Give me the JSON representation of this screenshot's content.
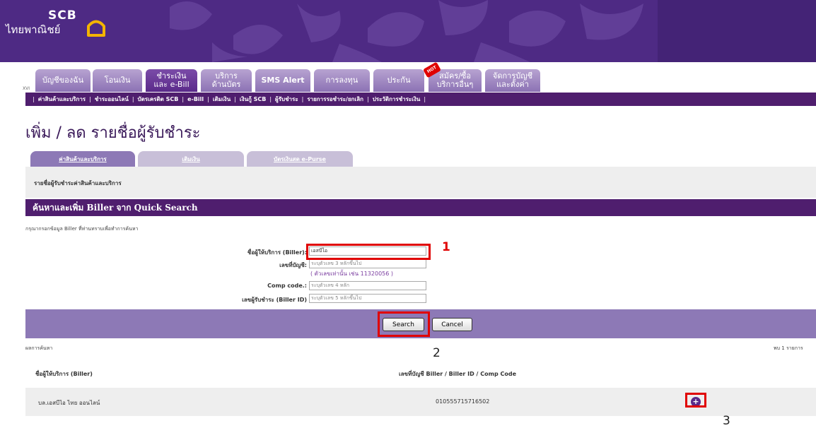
{
  "brand": {
    "name": "SCB",
    "thai_name": "ไทยพาณิชย์"
  },
  "nav": {
    "xvi": "XVI",
    "tabs": [
      {
        "label": "บัญชีของฉัน"
      },
      {
        "label": "โอนเงิน"
      },
      {
        "label": "ชำระเงิน\nและ e-Bill"
      },
      {
        "label": "บริการ\nด้านบัตร"
      },
      {
        "label": "SMS Alert"
      },
      {
        "label": "การลงทุน"
      },
      {
        "label": "ประกัน"
      },
      {
        "label": "สมัคร/ซื้อ\nบริการอื่นๆ"
      },
      {
        "label": "จัดการบัญชี\nและตั้งค่า"
      }
    ],
    "hot_badge": "HOT"
  },
  "subnav": {
    "items": [
      "ค่าสินค้าและบริการ",
      "ชำระออนไลน์",
      "บัตรเครดิต SCB",
      "e-Bill",
      "เติมเงิน",
      "เงินกู้ SCB",
      "ผู้รับชำระ",
      "รายการรอชำระ/ยกเลิก",
      "ประวัติการชำระเงิน"
    ]
  },
  "page": {
    "title": "เพิ่ม / ลด รายชื่อผู้รับชำระ"
  },
  "content_tabs": [
    "ค่าสินค้าและบริการ",
    "เติมเงิน",
    "บัตรเงินสด e-Purse"
  ],
  "section": {
    "list_label": "รายชื่อผู้รับชำระค่าสินค้าและบริการ",
    "search_header": "ค้นหาและเพิ่ม Biller จาก Quick Search",
    "hint": "กรุณากรอกข้อมูล Biller ที่ท่านทราบเพื่อทำการค้นหา"
  },
  "form": {
    "biller_label": "ชื่อผู้ให้บริการ (Biller):",
    "biller_value": "เอสบีไอ",
    "account_label": "เลขที่บัญชี:",
    "account_placeholder": "ระบุตัวเลข 3 หลักขึ้นไป",
    "account_note": "( ตัวเลขเท่านั้น เช่น 11320056 )",
    "comp_label": "Comp code.:",
    "comp_placeholder": "ระบุตัวเลข 4 หลัก",
    "billerid_label": "เลขผู้รับชำระ (Biller ID)",
    "billerid_placeholder": "ระบุตัวเลข 5 หลักขึ้นไป"
  },
  "buttons": {
    "search": "Search",
    "cancel": "Cancel"
  },
  "steps": {
    "one": "1",
    "two": "2",
    "three": "3"
  },
  "results": {
    "label": "ผลการค้นหา",
    "count": "พบ 1 รายการ",
    "columns": [
      "ชื่อผู้ให้บริการ (Biller)",
      "เลขที่บัญชี Biller / Biller ID / Comp Code"
    ],
    "rows": [
      {
        "biller": "บล.เอสบีไอ ไทย ออนไลน์",
        "account": "010555715716502"
      }
    ]
  },
  "colors": {
    "brand_purple": "#4f1e6e",
    "accent_red": "#e00000",
    "bar_lavender": "#8d79b6"
  },
  "icons": {
    "add": "plus-circle-icon",
    "logo": "house-icon"
  }
}
